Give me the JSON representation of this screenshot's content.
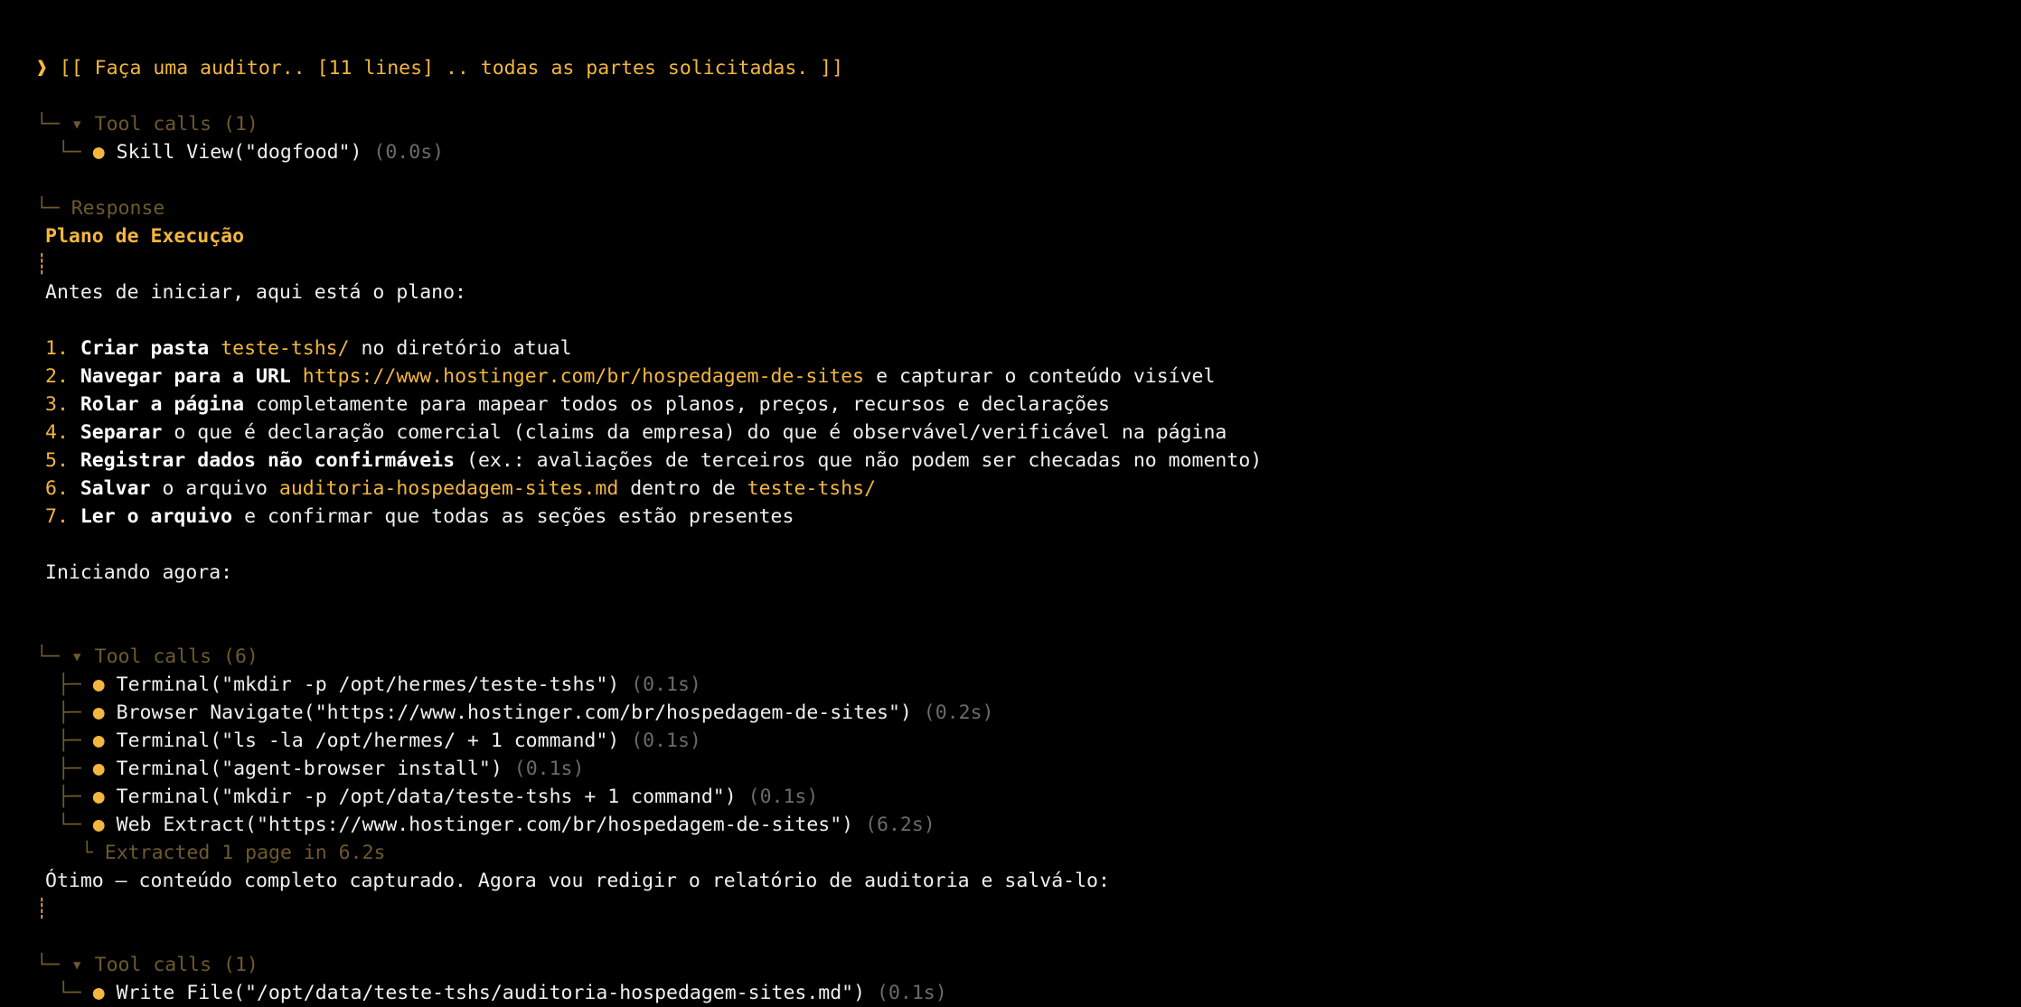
{
  "prompt": {
    "marker": "❱",
    "text": "[[ Faça uma auditor.. [11 lines] .. todas as partes solicitadas. ]]"
  },
  "tool_calls_1": {
    "header": "▾ Tool calls (1)",
    "items": [
      {
        "label": "Skill View(\"dogfood\")",
        "time": "(0.0s)"
      }
    ]
  },
  "response": {
    "label": "Response"
  },
  "plan": {
    "title": "Plano de Execução",
    "intro": "Antes de iniciar, aqui está o plano:",
    "steps": [
      {
        "num": "1.",
        "bold": "Criar pasta",
        "pre": " ",
        "hl": "teste-tshs/",
        "post": " no diretório atual",
        "hl2": "",
        "post2": ""
      },
      {
        "num": "2.",
        "bold": "Navegar para a URL",
        "pre": " ",
        "hl": "https://www.hostinger.com/br/hospedagem-de-sites",
        "post": " e capturar o conteúdo visível",
        "hl2": "",
        "post2": ""
      },
      {
        "num": "3.",
        "bold": "Rolar a página",
        "pre": " completamente para mapear todos os planos, preços, recursos e declarações",
        "hl": "",
        "post": "",
        "hl2": "",
        "post2": ""
      },
      {
        "num": "4.",
        "bold": "Separar",
        "pre": " o que é declaração comercial (claims da empresa) do que é observável/verificável na página",
        "hl": "",
        "post": "",
        "hl2": "",
        "post2": ""
      },
      {
        "num": "5.",
        "bold": "Registrar dados não confirmáveis",
        "pre": " (ex.: avaliações de terceiros que não podem ser checadas no momento)",
        "hl": "",
        "post": "",
        "hl2": "",
        "post2": ""
      },
      {
        "num": "6.",
        "bold": "Salvar",
        "pre": " o arquivo ",
        "hl": "auditoria-hospedagem-sites.md",
        "post": " dentro de ",
        "hl2": "teste-tshs/",
        "post2": ""
      },
      {
        "num": "7.",
        "bold": "Ler o arquivo",
        "pre": " e confirmar que todas as seções estão presentes",
        "hl": "",
        "post": "",
        "hl2": "",
        "post2": ""
      }
    ],
    "starting": "Iniciando agora:"
  },
  "tool_calls_6": {
    "header": "▾ Tool calls (6)",
    "items": [
      {
        "label": "Terminal(\"mkdir -p /opt/hermes/teste-tshs\")",
        "time": "(0.1s)"
      },
      {
        "label": "Browser Navigate(\"https://www.hostinger.com/br/hospedagem-de-sites\")",
        "time": "(0.2s)"
      },
      {
        "label": "Terminal(\"ls -la /opt/hermes/ + 1 command\")",
        "time": "(0.1s)"
      },
      {
        "label": "Terminal(\"agent-browser install\")",
        "time": "(0.1s)"
      },
      {
        "label": "Terminal(\"mkdir -p /opt/data/teste-tshs + 1 command\")",
        "time": "(0.1s)"
      },
      {
        "label": "Web Extract(\"https://www.hostinger.com/br/hospedagem-de-sites\")",
        "time": "(6.2s)"
      }
    ],
    "sub_result": "Extracted 1 page in 6.2s"
  },
  "message_2": {
    "text": "Ótimo — conteúdo completo capturado. Agora vou redigir o relatório de auditoria e salvá-lo:"
  },
  "tool_calls_last": {
    "header": "▾ Tool calls (1)",
    "items": [
      {
        "label": "Write File(\"/opt/data/teste-tshs/auditoria-hospedagem-sites.md\")",
        "time": "(0.1s)"
      }
    ]
  },
  "glyphs": {
    "elbow": "└─",
    "tee": "├─",
    "sub_elbow": "└",
    "bullet": "●",
    "bar": "┊"
  },
  "colors": {
    "accent": "#f4b63e",
    "dim": "#6e5a2c",
    "muted": "#6b6b6b",
    "text": "#e9e9e9",
    "background": "#000000"
  }
}
